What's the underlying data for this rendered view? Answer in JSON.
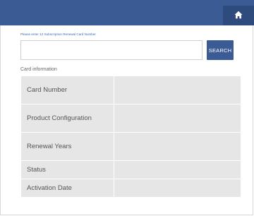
{
  "header": {
    "home_icon": "home-icon",
    "colors": {
      "bar": "#3b5b95",
      "home_button": "#2f4a7d",
      "accent_text": "#3a66c0"
    }
  },
  "search": {
    "hint": "Please enter 12 Subscription Renewal Card Number",
    "value": "",
    "button_label": "SEARCH"
  },
  "card_info": {
    "section_label": "Card information",
    "rows": [
      {
        "label": "Card Number",
        "value": ""
      },
      {
        "label": "Product Configuration",
        "value": ""
      },
      {
        "label": "Renewal Years",
        "value": ""
      },
      {
        "label": "Status",
        "value": ""
      },
      {
        "label": "Activation Date",
        "value": ""
      }
    ]
  }
}
